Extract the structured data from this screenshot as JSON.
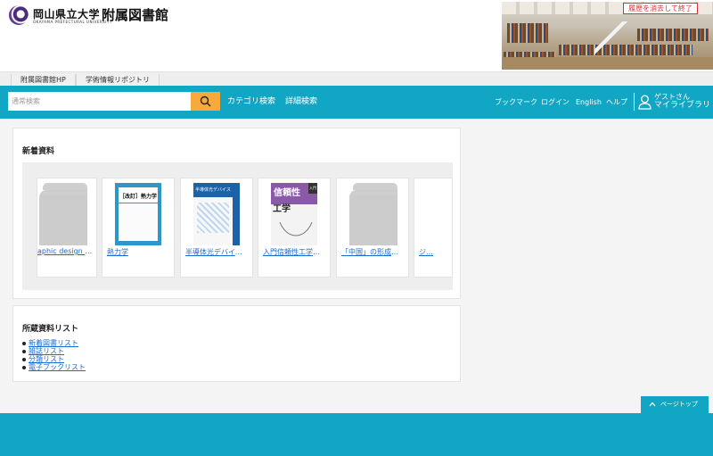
{
  "header": {
    "university": "岡山県立大学",
    "university_en": "OKAYAMA PREFECTURAL UNIVERSITY",
    "library": "附属図書館",
    "clear_history": "履歴を消去して終了"
  },
  "subtabs": [
    "附属図書館HP",
    "学術情報リポジトリ"
  ],
  "nav": {
    "search_placeholder": "通常検索",
    "category_search": "カテゴリ検索",
    "advanced_search": "詳細検索",
    "bookmark": "ブックマーク",
    "login": "ログイン",
    "english": "English",
    "help": "ヘルプ",
    "guest": "ゲストさん",
    "my_library": "マイライブラリ"
  },
  "new_arrivals": {
    "title": "新着資料",
    "items": [
      {
        "title": "aphic design i…"
      },
      {
        "title": "熱力学"
      },
      {
        "title": "半導体光デバイス…"
      },
      {
        "title": "入門信頼性工学：…"
      },
      {
        "title": "「中国」の形成：…"
      },
      {
        "title": "ジ…"
      }
    ],
    "covers": {
      "thermo_label": "熱力学",
      "thermo_series": "［改訂］",
      "semi_label": "半導体光デバイス",
      "rel_main": "信頼性",
      "rel_sub": "工学",
      "rel_badge": "入門"
    }
  },
  "holdings": {
    "title": "所蔵資料リスト",
    "items": [
      "新着図書リスト",
      "雑誌リスト",
      "分類リスト",
      "電子ブックリスト"
    ]
  },
  "page_top": "ページトップ",
  "colors": {
    "accent": "#10a6c4",
    "search_button": "#f7a93b",
    "link": "#1a6bd1",
    "warning": "#dd3333"
  }
}
